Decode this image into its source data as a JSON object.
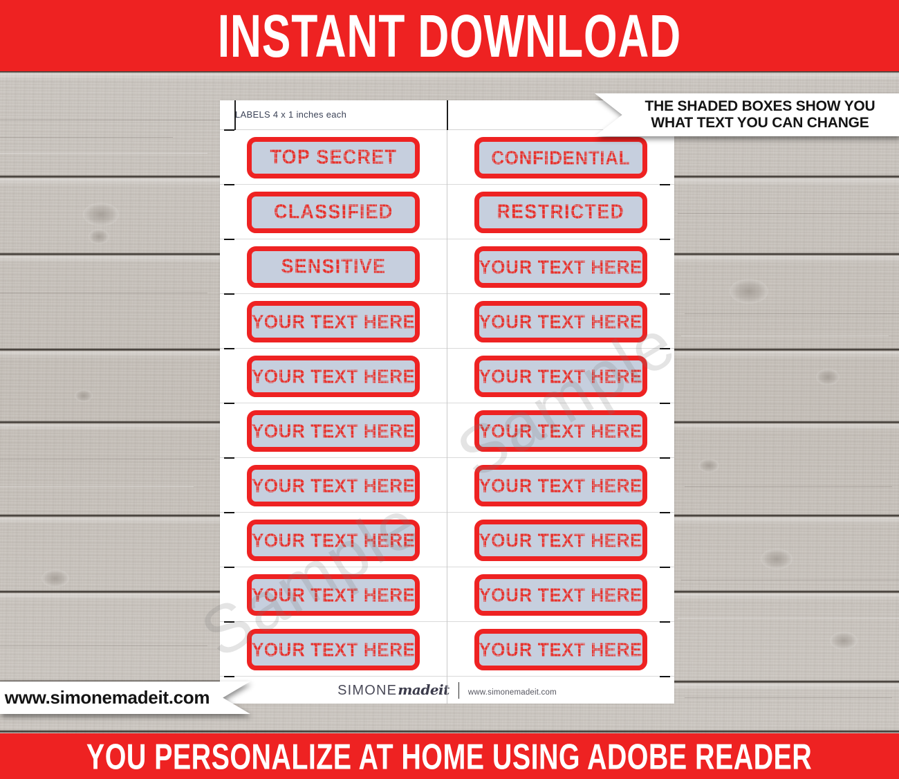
{
  "banners": {
    "top_text": "INSTANT DOWNLOAD",
    "bottom_text": "YOU PERSONALIZE AT HOME USING ADOBE READER",
    "banner_color": "#ee2222",
    "banner_text_color": "#ffffff"
  },
  "callout": {
    "line1": "THE SHADED BOXES SHOW YOU",
    "line2": "WHAT TEXT YOU CAN CHANGE"
  },
  "url_banner": {
    "text": "www.simonemadeit.com"
  },
  "sheet": {
    "header_text": "LABELS 4 x 1 inches each",
    "label_fill_color": "#c6cfde",
    "label_border_color": "#ee2222",
    "label_text_color": "#e8302a",
    "rows": [
      {
        "left": "TOP SECRET",
        "right": "CONFIDENTIAL"
      },
      {
        "left": "CLASSIFIED",
        "right": "RESTRICTED"
      },
      {
        "left": "SENSITIVE",
        "right": "YOUR TEXT HERE"
      },
      {
        "left": "YOUR TEXT HERE",
        "right": "YOUR TEXT HERE"
      },
      {
        "left": "YOUR TEXT HERE",
        "right": "YOUR TEXT HERE"
      },
      {
        "left": "YOUR TEXT HERE",
        "right": "YOUR TEXT HERE"
      },
      {
        "left": "YOUR TEXT HERE",
        "right": "YOUR TEXT HERE"
      },
      {
        "left": "YOUR TEXT HERE",
        "right": "YOUR TEXT HERE"
      },
      {
        "left": "YOUR TEXT HERE",
        "right": "YOUR TEXT HERE"
      },
      {
        "left": "YOUR TEXT HERE",
        "right": "YOUR TEXT HERE"
      }
    ],
    "footer": {
      "brand_primary": "SIMONE",
      "brand_script": "madeit",
      "brand_url": "www.simonemadeit.com"
    }
  },
  "watermarks": {
    "text": "Sample",
    "count": 2
  }
}
